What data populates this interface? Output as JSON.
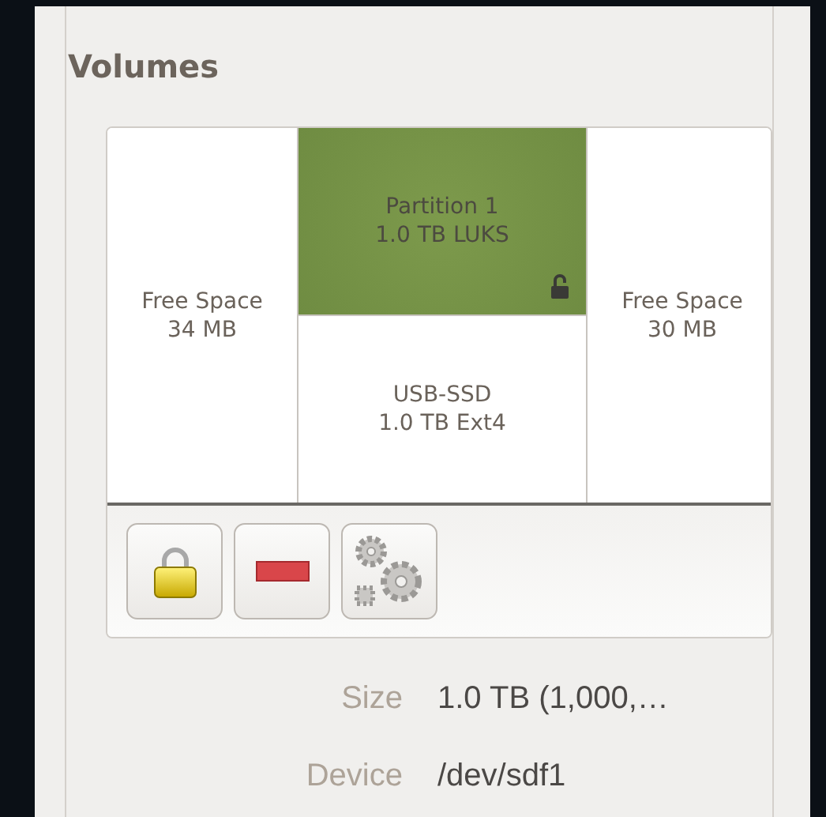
{
  "section": {
    "title": "Volumes"
  },
  "volume_map": [
    {
      "label": "Free Space",
      "size": "34 MB",
      "selected": false
    },
    {
      "label": "Partition 1",
      "size": "1.0 TB LUKS",
      "selected": true,
      "locked": false,
      "children": [
        {
          "label": "USB-SSD",
          "size": "1.0 TB Ext4",
          "selected": false
        }
      ]
    },
    {
      "label": "Free Space",
      "size": "30 MB",
      "selected": false
    }
  ],
  "details": [
    {
      "label": "Size",
      "value": "1.0 TB (1,000,…"
    },
    {
      "label": "Device",
      "value": "/dev/sdf1"
    }
  ]
}
